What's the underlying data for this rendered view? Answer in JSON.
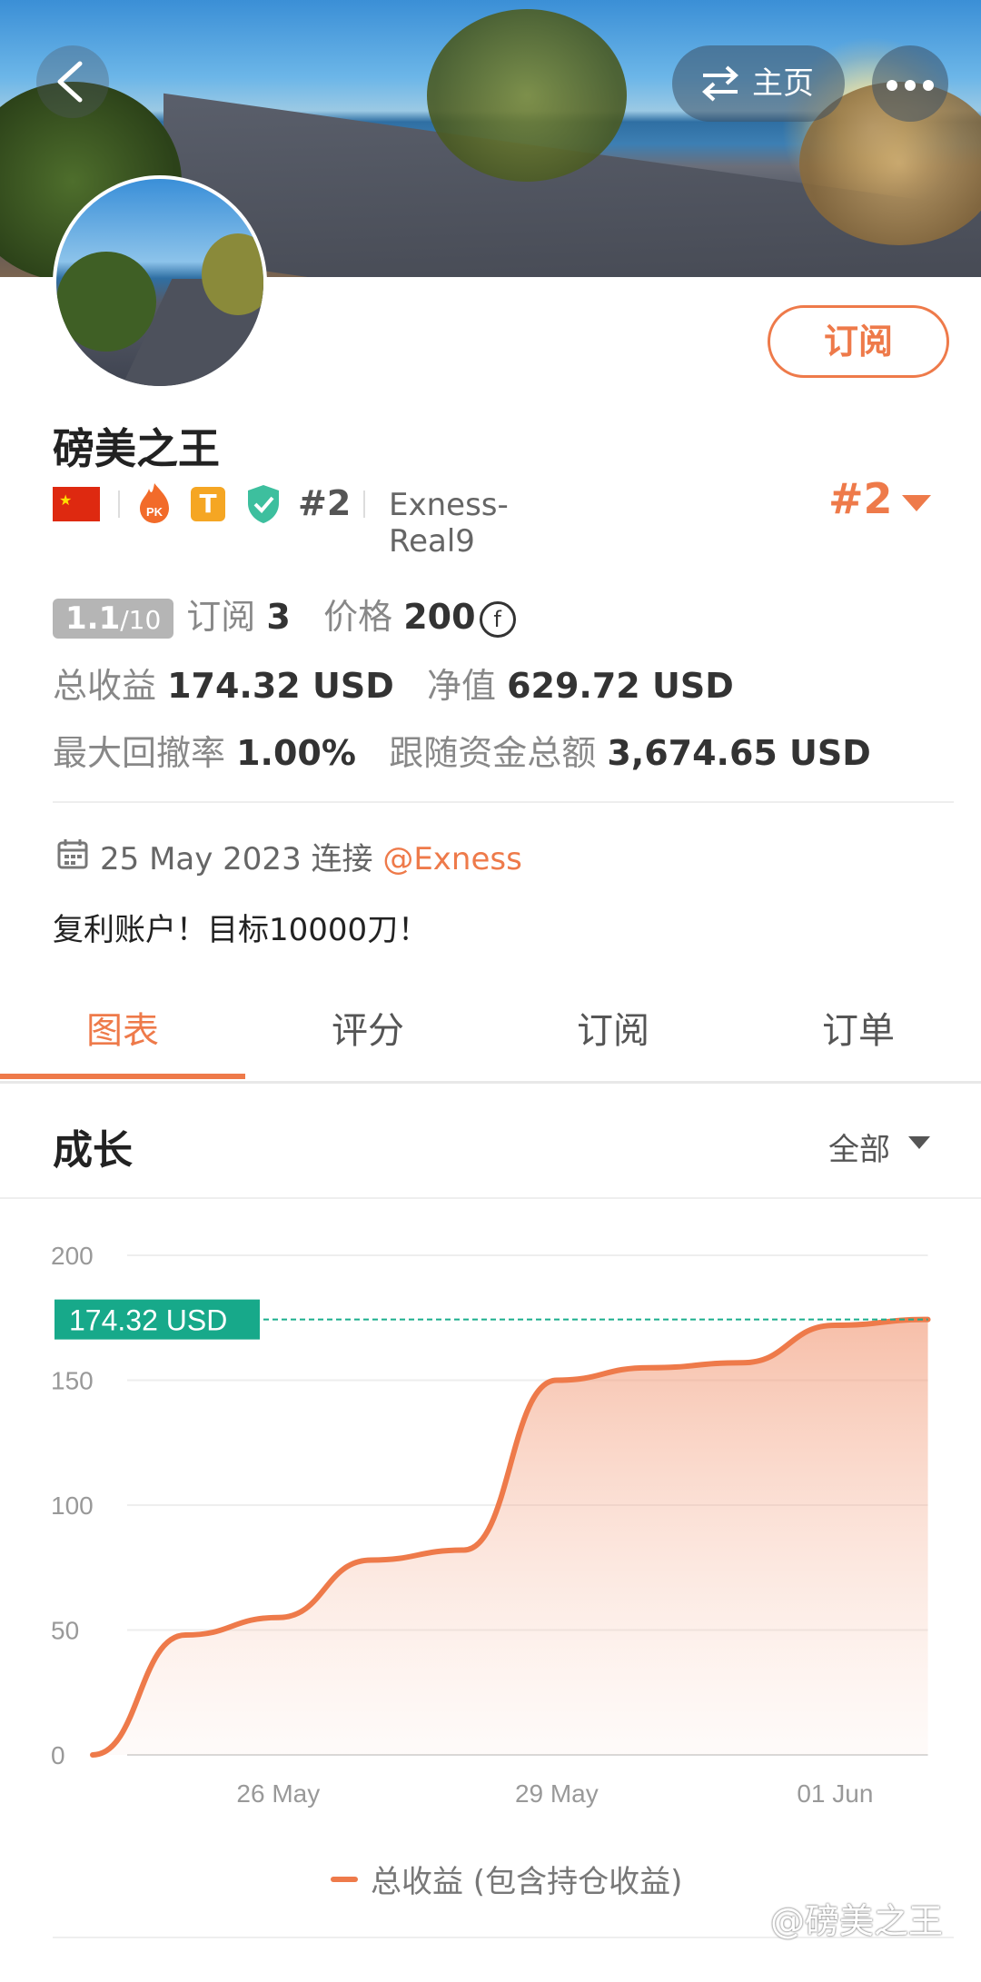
{
  "header": {
    "home_label": "主页"
  },
  "profile": {
    "name": "磅美之王",
    "subscribe_label": "订阅",
    "rank_small": "#2",
    "broker": "Exness-Real9",
    "rank_big": "#2",
    "flag_star": "★"
  },
  "stats": {
    "score_main": "1.1",
    "score_max": "/10",
    "subs_label": "订阅",
    "subs_value": "3",
    "price_label": "价格",
    "price_value": "200",
    "coin_symbol": "f",
    "total_profit_label": "总收益",
    "total_profit_value": "174.32 USD",
    "net_label": "净值",
    "net_value": "629.72 USD",
    "drawdown_label": "最大回撤率",
    "drawdown_value": "1.00%",
    "follow_label": "跟随资金总额",
    "follow_value": "3,674.65 USD"
  },
  "meta": {
    "date": "25 May 2023",
    "connect_label": "连接",
    "broker_link": "@Exness",
    "bio": "复利账户！目标10000刀！"
  },
  "tabs": [
    "图表",
    "评分",
    "订阅",
    "订单"
  ],
  "growth": {
    "title": "成长",
    "filter": "全部"
  },
  "chart_data": {
    "type": "area",
    "series": [
      {
        "name": "总收益 (包含持仓收益)",
        "color": "#ee7a4a",
        "x": [
          "24 May",
          "25 May",
          "26 May",
          "27 May",
          "28 May",
          "29 May",
          "30 May",
          "31 May",
          "01 Jun",
          "02 Jun"
        ],
        "y": [
          0,
          48,
          55,
          78,
          82,
          150,
          155,
          157,
          172,
          174.32
        ]
      }
    ],
    "yticks": [
      0,
      50,
      100,
      150,
      200
    ],
    "xtick_labels": [
      "26 May",
      "29 May",
      "01 Jun"
    ],
    "ylim": [
      0,
      200
    ],
    "current_label": "174.32 USD",
    "current_value": 174.32
  },
  "watermark": "@磅美之王"
}
